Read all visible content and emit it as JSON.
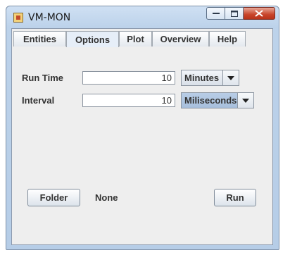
{
  "window": {
    "title": "VM-MON"
  },
  "tabs": [
    {
      "label": "Entities"
    },
    {
      "label": "Options"
    },
    {
      "label": "Plot"
    },
    {
      "label": "Overview"
    },
    {
      "label": "Help"
    }
  ],
  "active_tab": "Options",
  "form": {
    "run_time": {
      "label": "Run Time",
      "value": "10",
      "unit": "Minutes"
    },
    "interval": {
      "label": "Interval",
      "value": "10",
      "unit": "Miliseconds"
    }
  },
  "folder": {
    "button_label": "Folder",
    "value": "None"
  },
  "run_button_label": "Run",
  "colors": {
    "accent": "#b8cde6",
    "close": "#c8452b"
  }
}
